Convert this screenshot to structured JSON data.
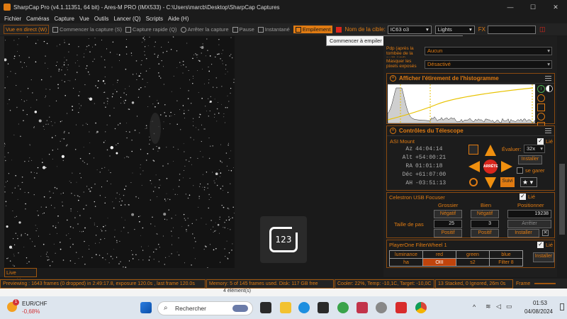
{
  "titlebar": {
    "title": "SharpCap Pro (v4.1.11351, 64 bit) - Ares-M PRO (IMX533) - C:\\Users\\marcb\\Desktop\\SharpCap Captures",
    "minimize": "—",
    "maximize": "☐",
    "close": "✕"
  },
  "menu": [
    "Fichier",
    "Caméras",
    "Capture",
    "Vue",
    "Outils",
    "Lancer (Q)",
    "Scripts",
    "Aide (H)"
  ],
  "toolbar": {
    "live_view": "Vue en direct (W)",
    "start_capture": "Commencer la capture (S)",
    "quick_capture": "Capture rapide (Q)",
    "stop_capture": "Arrêter la capture",
    "pause": "Pause",
    "snapshot": "Instantané",
    "stacking": "Empilement",
    "target_label": "Nom de la cible:",
    "target_value": "IC63 o3",
    "frame_type": "Lights",
    "fx_label": "FX"
  },
  "tooltip": "Commencer à empiler des images pour le ciel profond",
  "left_overlay": {
    "live_stacking": "Live Stacking",
    "app_badge": "123"
  },
  "right_panel": {
    "top_rows": [
      {
        "label": "Pdp (après la tombée de la nuit) (ctrl)",
        "value": "Aucun"
      },
      {
        "label": "Masquer les pixels exposés",
        "value": "Désactivé"
      }
    ],
    "histogram": {
      "title": "Afficher l'étirement de l'histogramme",
      "side_icons": [
        "info-icon",
        "contrast-icon",
        "lightning-icon",
        "save-icon",
        "refresh-icon",
        "reset-icon"
      ]
    },
    "telescope": {
      "title": "Contrôles du Télescope",
      "linked_label": "Lié",
      "mount_name": "ASI Mount",
      "coords": [
        {
          "label": "Az",
          "value": "44:04:14"
        },
        {
          "label": "Alt",
          "value": "+54:00:21"
        },
        {
          "label": "RA",
          "value": "01:01:18"
        },
        {
          "label": "Déc",
          "value": "+61:07:00"
        },
        {
          "label": "AH",
          "value": "-03:51:13"
        }
      ],
      "stop_label": "ARRÊTE",
      "rate_label": "Évaluer:",
      "rate_value": "32x",
      "install_label": "Installer",
      "park_label": "se garer",
      "track_label": "Suivi"
    },
    "focuser": {
      "name": "Celestron USB Focuser",
      "linked_label": "Lié",
      "col_coarse": "Grossier",
      "col_fine": "Bien",
      "col_position": "Positionner",
      "negative_label": "Négatif",
      "positive_label": "Positif",
      "step_label": "Taille de pas",
      "coarse_step": "25",
      "fine_step": "3",
      "position_value": "19238",
      "stop_label": "Arrêter",
      "install_label": "Installer"
    },
    "filterwheel": {
      "name": "PlayerOne FilterWheel 1",
      "linked_label": "Lié",
      "filters_row1": [
        "luminance",
        "red",
        "green",
        "blue"
      ],
      "filters_row2": [
        "ha",
        "OIII",
        "s2",
        "Filter 8"
      ],
      "selected": "OIII",
      "install_label": "Installer"
    }
  },
  "status": {
    "preview": "Previewing : 1643 frames (0 dropped) in 2:49:17.8, exposure 120.0s , last frame 120.0s",
    "memory": "Memory: 5 of 145 frames used. Disk: 117 GB free",
    "cooler": "Cooler: 22%, Temp: -10,1C, Target: -10,0C",
    "stacked": "13 Stacked, 0 Ignored, 26m 0s",
    "frame_label": "Frame",
    "below_text": "4 élément(s)"
  },
  "taskbar": {
    "weather_pair": "EUR/CHF",
    "weather_change": "-0,68%",
    "notification_count": "1",
    "search_placeholder": "Rechercher",
    "time": "01:53",
    "date": "04/08/2024",
    "colors": {
      "bg": "#dde5ee",
      "change": "#d13438"
    }
  },
  "colors": {
    "accent": "#e07b12",
    "background": "#1a1a1a",
    "selected_filter": "#c0440c",
    "stop_button": "#d9261c"
  }
}
